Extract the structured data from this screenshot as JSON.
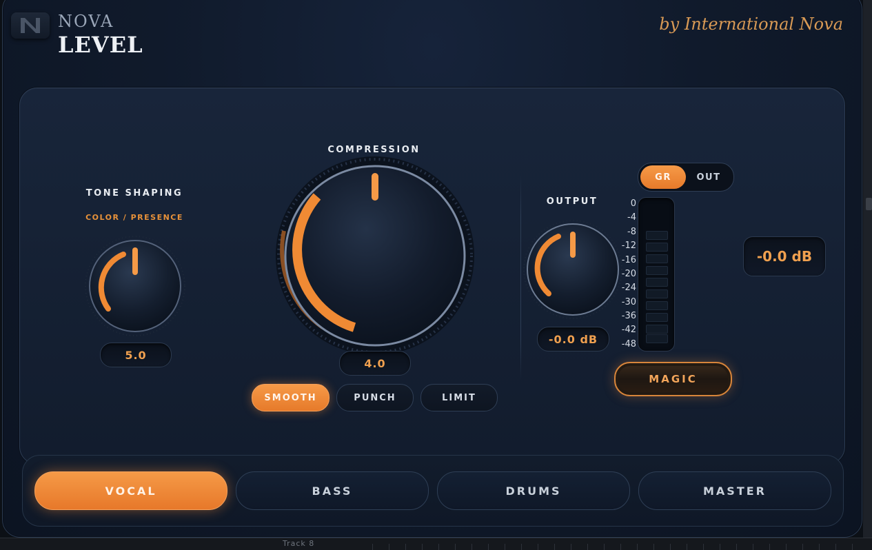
{
  "header": {
    "brand_top": "NOVA",
    "brand_main": "LEVEL",
    "tagline": "by International Nova"
  },
  "tone": {
    "title": "TONE SHAPING",
    "subtitle": "COLOR / PRESENCE",
    "value": "5.0"
  },
  "compression": {
    "title": "COMPRESSION",
    "value": "4.0",
    "modes": [
      "SMOOTH",
      "PUNCH",
      "LIMIT"
    ],
    "active_mode": "SMOOTH"
  },
  "output": {
    "title": "OUTPUT",
    "value": "-0.0 dB"
  },
  "meter": {
    "toggle": [
      "GR",
      "OUT"
    ],
    "active": "GR",
    "scale": [
      "0",
      "-4",
      "-8",
      "-12",
      "-16",
      "-20",
      "-24",
      "-30",
      "-36",
      "-42",
      "-48"
    ],
    "readout": "-0.0 dB"
  },
  "magic": {
    "label": "MAGIC"
  },
  "presets": {
    "items": [
      "VOCAL",
      "BASS",
      "DRUMS",
      "MASTER"
    ],
    "active": "VOCAL"
  },
  "daw": {
    "track_label": "Track 8"
  },
  "colors": {
    "accent": "#f08a34",
    "panel": "#121c2d",
    "text": "#e9edf2"
  }
}
